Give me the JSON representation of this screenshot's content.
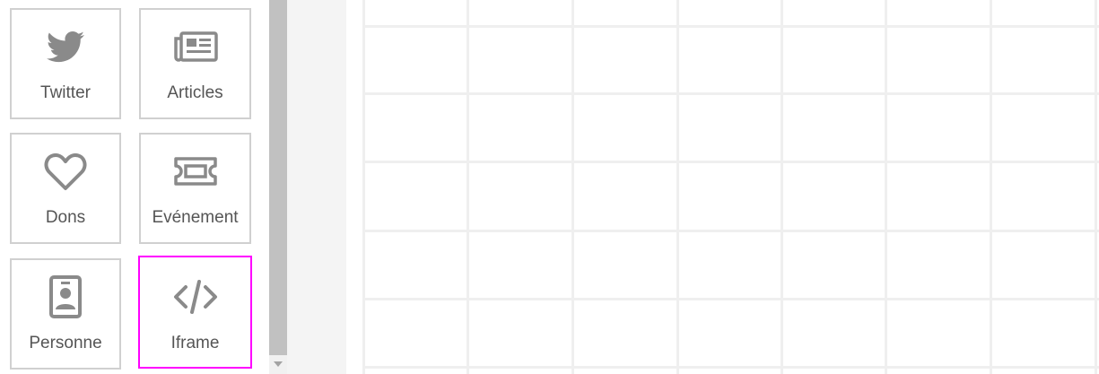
{
  "widgets": [
    {
      "label": "Twitter",
      "icon": "twitter-icon"
    },
    {
      "label": "Articles",
      "icon": "newspaper-icon"
    },
    {
      "label": "Dons",
      "icon": "heart-icon"
    },
    {
      "label": "Evénement",
      "icon": "ticket-icon"
    },
    {
      "label": "Personne",
      "icon": "id-badge-icon"
    },
    {
      "label": "Iframe",
      "icon": "code-icon",
      "selected": true
    }
  ],
  "colors": {
    "selected_border": "#ff00ff",
    "tile_border": "#d0d0d0",
    "icon": "#8a8a8a",
    "label": "#555555",
    "grid_line": "#efefef"
  }
}
